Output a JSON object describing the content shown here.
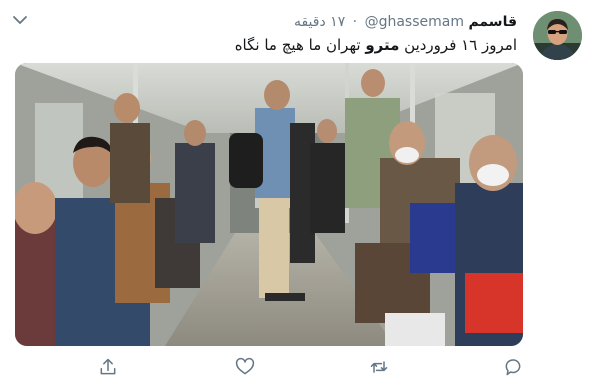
{
  "tweet": {
    "display_name": "قاسمم",
    "handle": "@ghassemam",
    "separator": "·",
    "timestamp": "۱۷ دقیقه",
    "text_part1": "امروز ۱٦ فروردین ",
    "text_bold": "مترو",
    "text_part2": " تهران ما هیچ ما نگاه"
  },
  "icons": {
    "menu": "chevron-down-icon",
    "reply": "reply-icon",
    "retweet": "retweet-icon",
    "like": "heart-icon",
    "share": "share-icon"
  },
  "colors": {
    "text": "#14171a",
    "secondary": "#657786",
    "icon": "#657786"
  }
}
